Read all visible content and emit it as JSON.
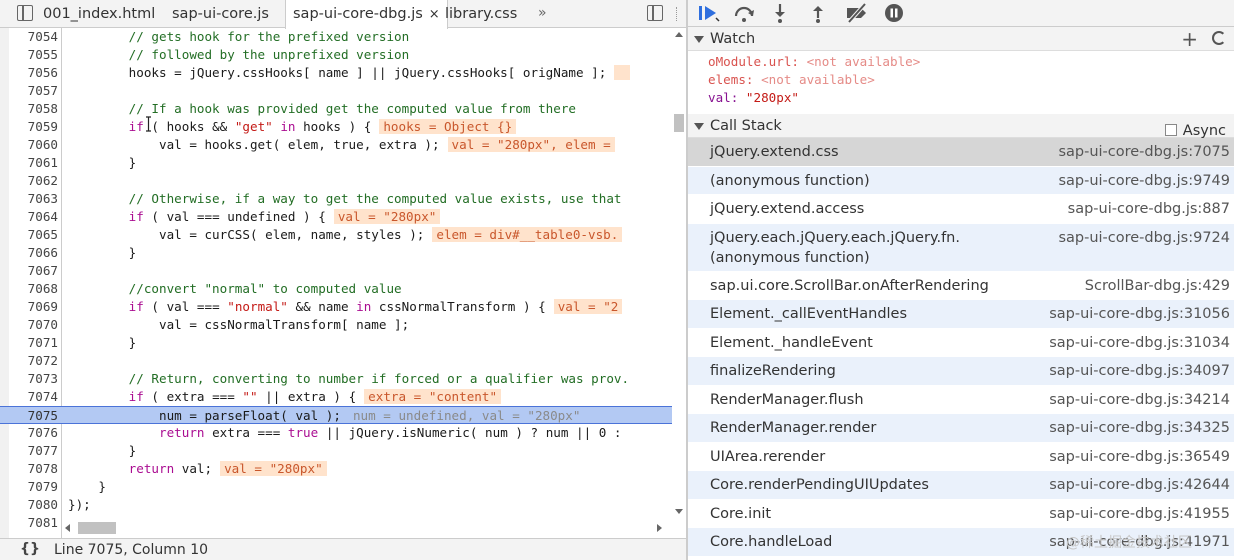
{
  "tabs": [
    {
      "label": "001_index.html",
      "active": false
    },
    {
      "label": "sap-ui-core.js",
      "active": false
    },
    {
      "label": "sap-ui-core-dbg.js",
      "active": true,
      "close": "×"
    },
    {
      "label": "library.css",
      "active": false
    }
  ],
  "tabs_more": "»",
  "code_lines": [
    {
      "num": "7054",
      "segs": [
        [
          "cmt",
          "        // gets hook for the prefixed version"
        ]
      ]
    },
    {
      "num": "7055",
      "segs": [
        [
          "cmt",
          "        // followed by the unprefixed version"
        ]
      ]
    },
    {
      "num": "7056",
      "segs": [
        [
          "plain",
          "        hooks = jQuery.cssHooks[ name ] || jQuery.cssHooks[ origName ];"
        ]
      ],
      "ann": " "
    },
    {
      "num": "7057",
      "segs": []
    },
    {
      "num": "7058",
      "segs": [
        [
          "cmt",
          "        // If a hook was provided get the computed value from there"
        ]
      ]
    },
    {
      "num": "7059",
      "segs": [
        [
          "kw",
          "        if"
        ],
        [
          "plain",
          " ( hooks && "
        ],
        [
          "str",
          "\"get\""
        ],
        [
          "kw",
          " in"
        ],
        [
          "plain",
          " hooks ) {"
        ]
      ],
      "ann": "hooks = Object {}"
    },
    {
      "num": "7060",
      "segs": [
        [
          "plain",
          "            val = hooks.get( elem, "
        ],
        [
          "plain",
          "true, extra );"
        ]
      ],
      "ann": "val = \"280px\", elem ="
    },
    {
      "num": "7061",
      "segs": [
        [
          "plain",
          "        }"
        ]
      ]
    },
    {
      "num": "7062",
      "segs": []
    },
    {
      "num": "7063",
      "segs": [
        [
          "cmt",
          "        // Otherwise, if a way to get the computed value exists, use that"
        ]
      ]
    },
    {
      "num": "7064",
      "segs": [
        [
          "kw",
          "        if"
        ],
        [
          "plain",
          " ( val === "
        ],
        [
          "plain",
          "undefined ) {"
        ]
      ],
      "ann": "val = \"280px\""
    },
    {
      "num": "7065",
      "segs": [
        [
          "plain",
          "            val = curCSS( elem, name, styles );"
        ]
      ],
      "ann": "elem = div#__table0-vsb."
    },
    {
      "num": "7066",
      "segs": [
        [
          "plain",
          "        }"
        ]
      ]
    },
    {
      "num": "7067",
      "segs": []
    },
    {
      "num": "7068",
      "segs": [
        [
          "cmt",
          "        //convert \"normal\" to computed value"
        ]
      ]
    },
    {
      "num": "7069",
      "segs": [
        [
          "kw",
          "        if"
        ],
        [
          "plain",
          " ( val === "
        ],
        [
          "str",
          "\"normal\""
        ],
        [
          "plain",
          " && name "
        ],
        [
          "kw",
          "in"
        ],
        [
          "plain",
          " cssNormalTransform ) {"
        ]
      ],
      "ann": "val = \"2"
    },
    {
      "num": "7070",
      "segs": [
        [
          "plain",
          "            val = cssNormalTransform[ name ];"
        ]
      ]
    },
    {
      "num": "7071",
      "segs": [
        [
          "plain",
          "        }"
        ]
      ]
    },
    {
      "num": "7072",
      "segs": []
    },
    {
      "num": "7073",
      "segs": [
        [
          "cmt",
          "        // Return, converting to number if forced or a qualifier was prov."
        ]
      ]
    },
    {
      "num": "7074",
      "segs": [
        [
          "kw",
          "        if"
        ],
        [
          "plain",
          " ( extra === "
        ],
        [
          "str",
          "\"\""
        ],
        [
          "plain",
          " || extra ) {"
        ]
      ],
      "ann": "extra = \"content\""
    },
    {
      "num": "7075",
      "segs": [
        [
          "plain",
          "            num = parseFloat( val );"
        ]
      ],
      "ann": "num = undefined, val = \"280px\"",
      "exec": true
    },
    {
      "num": "7076",
      "segs": [
        [
          "kw",
          "            return"
        ],
        [
          "plain",
          " extra === "
        ],
        [
          "kw",
          "true"
        ],
        [
          "plain",
          " || jQuery.isNumeric( num ) ? num || 0 :"
        ]
      ]
    },
    {
      "num": "7077",
      "segs": [
        [
          "plain",
          "        }"
        ]
      ]
    },
    {
      "num": "7078",
      "segs": [
        [
          "kw",
          "        return"
        ],
        [
          "plain",
          " val;"
        ]
      ],
      "ann": "val = \"280px\""
    },
    {
      "num": "7079",
      "segs": [
        [
          "plain",
          "    }"
        ]
      ]
    },
    {
      "num": "7080",
      "segs": [
        [
          "plain",
          "});"
        ]
      ]
    },
    {
      "num": "7081",
      "segs": []
    }
  ],
  "status": {
    "braces": "{}",
    "position": "Line 7075, Column 10"
  },
  "watch": {
    "title": "Watch",
    "add": "+",
    "items": [
      {
        "key": "oModule.url",
        "value": "<not available>",
        "kind": "na"
      },
      {
        "key": "elems",
        "value": "<not available>",
        "kind": "na"
      },
      {
        "key": "val",
        "value": "\"280px\"",
        "kind": "ok"
      }
    ]
  },
  "callstack": {
    "title": "Call Stack",
    "async_label": "Async",
    "frames": [
      {
        "fn": "jQuery.extend.css",
        "loc": "sap-ui-core-dbg.js:7075"
      },
      {
        "fn": "(anonymous function)",
        "loc": "sap-ui-core-dbg.js:9749"
      },
      {
        "fn": "jQuery.extend.access",
        "loc": "sap-ui-core-dbg.js:887"
      },
      {
        "fn": "jQuery.each.jQuery.each.jQuery.fn.(anonymous function)",
        "loc": "sap-ui-core-dbg.js:9724"
      },
      {
        "fn": "sap.ui.core.ScrollBar.onAfterRendering",
        "loc": "ScrollBar-dbg.js:429"
      },
      {
        "fn": "Element._callEventHandles",
        "loc": "sap-ui-core-dbg.js:31056"
      },
      {
        "fn": "Element._handleEvent",
        "loc": "sap-ui-core-dbg.js:31034"
      },
      {
        "fn": "finalizeRendering",
        "loc": "sap-ui-core-dbg.js:34097"
      },
      {
        "fn": "RenderManager.flush",
        "loc": "sap-ui-core-dbg.js:34214"
      },
      {
        "fn": "RenderManager.render",
        "loc": "sap-ui-core-dbg.js:34325"
      },
      {
        "fn": "UIArea.rerender",
        "loc": "sap-ui-core-dbg.js:36549"
      },
      {
        "fn": "Core.renderPendingUIUpdates",
        "loc": "sap-ui-core-dbg.js:42644"
      },
      {
        "fn": "Core.init",
        "loc": "sap-ui-core-dbg.js:41955"
      },
      {
        "fn": "Core.handleLoad",
        "loc": "sap-ui-core-dbg.js:41971"
      }
    ]
  },
  "watermark": "@稀土掘金技术社区",
  "colors": {
    "accent": "#4b73d8",
    "exec_line": "#b3c9f3",
    "annotation_bg": "#ffe3cc",
    "selected_frame": "#d6d6d6"
  }
}
